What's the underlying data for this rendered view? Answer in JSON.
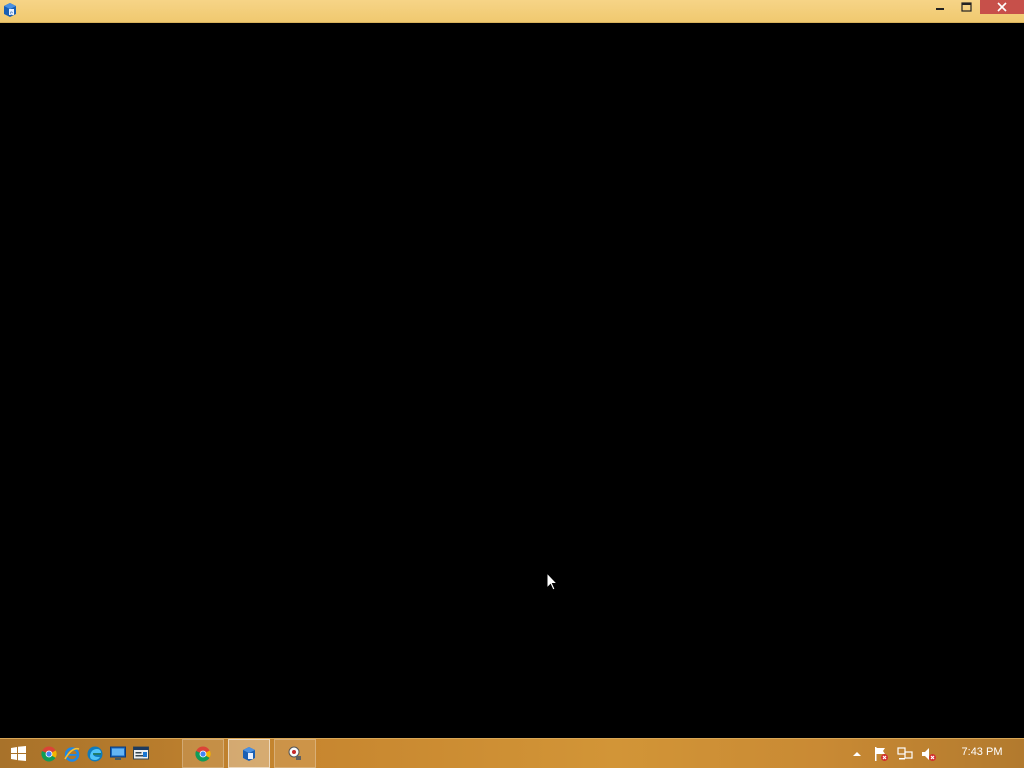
{
  "window": {
    "title": "",
    "buttons": {
      "minimize": "minimize",
      "maximize": "maximize",
      "close": "close"
    },
    "colors": {
      "titlebar": "#f0c96f",
      "close_button": "#c7504a",
      "client_background": "#000000"
    }
  },
  "taskbar": {
    "start_icon": "windows-logo-icon",
    "pinned": [
      {
        "name": "chrome-icon"
      },
      {
        "name": "internet-explorer-icon"
      },
      {
        "name": "edge-icon"
      },
      {
        "name": "remote-desktop-icon"
      },
      {
        "name": "server-manager-icon"
      }
    ],
    "running": [
      {
        "name": "chrome-icon",
        "active": false
      },
      {
        "name": "app-icon",
        "active": true
      },
      {
        "name": "tool-icon",
        "active": false
      }
    ],
    "tray": {
      "icons": [
        "show-hidden-icons-chevron",
        "action-center-flag-icon",
        "network-icon",
        "volume-muted-icon"
      ],
      "clock": "7:43 PM"
    }
  }
}
